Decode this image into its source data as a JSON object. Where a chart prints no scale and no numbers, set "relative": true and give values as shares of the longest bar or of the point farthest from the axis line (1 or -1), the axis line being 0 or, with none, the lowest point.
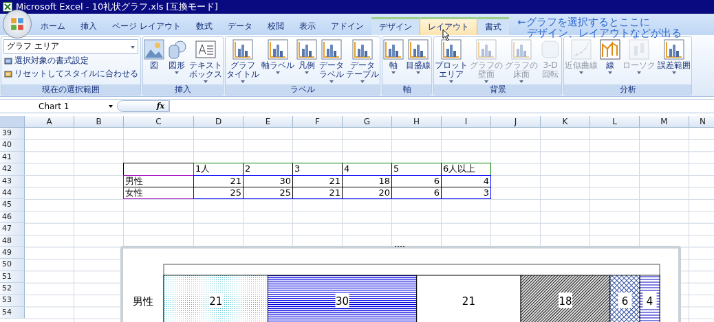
{
  "window": {
    "title": "Microsoft Excel - 10礼状グラフ.xls  [互換モード]"
  },
  "tabs": [
    {
      "label": "ホーム",
      "selected": false,
      "contextual": false
    },
    {
      "label": "挿入",
      "selected": false,
      "contextual": false
    },
    {
      "label": "ページ レイアウト",
      "selected": false,
      "contextual": false
    },
    {
      "label": "数式",
      "selected": false,
      "contextual": false
    },
    {
      "label": "データ",
      "selected": false,
      "contextual": false
    },
    {
      "label": "校閲",
      "selected": false,
      "contextual": false
    },
    {
      "label": "表示",
      "selected": false,
      "contextual": false
    },
    {
      "label": "アドイン",
      "selected": false,
      "contextual": false
    },
    {
      "label": "デザイン",
      "selected": false,
      "contextual": true
    },
    {
      "label": "レイアウト",
      "selected": true,
      "contextual": true
    },
    {
      "label": "書式",
      "selected": false,
      "contextual": true
    }
  ],
  "annotation": [
    "←グラフを選択するとここに",
    "デザイン、レイアウトなどが出る"
  ],
  "ribbon": [
    {
      "label": "現在の選択範囲",
      "kind": "selection",
      "dropdown": "グラフ エリア",
      "links": [
        "選択対象の書式設定",
        "リセットしてスタイルに合わせる"
      ]
    },
    {
      "label": "挿入",
      "kind": "buttons",
      "items": [
        {
          "lines": [
            "図"
          ],
          "dropdown": false,
          "disabled": false
        },
        {
          "lines": [
            "図形"
          ],
          "dropdown": true,
          "disabled": false
        },
        {
          "lines": [
            "テキスト",
            "ボックス"
          ],
          "dropdown": true,
          "disabled": false
        }
      ]
    },
    {
      "label": "ラベル",
      "kind": "buttons",
      "items": [
        {
          "lines": [
            "グラフ",
            "タイトル"
          ],
          "dropdown": true,
          "disabled": false
        },
        {
          "lines": [
            "軸ラベル"
          ],
          "dropdown": true,
          "disabled": false
        },
        {
          "lines": [
            "凡例"
          ],
          "dropdown": true,
          "disabled": false
        },
        {
          "lines": [
            "データ",
            "ラベル"
          ],
          "dropdown": true,
          "disabled": false
        },
        {
          "lines": [
            "データ",
            "テーブル"
          ],
          "dropdown": true,
          "disabled": false
        }
      ]
    },
    {
      "label": "軸",
      "kind": "buttons",
      "items": [
        {
          "lines": [
            "軸"
          ],
          "dropdown": true,
          "disabled": false
        },
        {
          "lines": [
            "目盛線"
          ],
          "dropdown": true,
          "disabled": false
        }
      ]
    },
    {
      "label": "背景",
      "kind": "buttons",
      "items": [
        {
          "lines": [
            "プロット",
            "エリア"
          ],
          "dropdown": true,
          "disabled": false
        },
        {
          "lines": [
            "グラフの",
            "壁面"
          ],
          "dropdown": true,
          "disabled": true
        },
        {
          "lines": [
            "グラフの",
            "床面"
          ],
          "dropdown": true,
          "disabled": true
        },
        {
          "lines": [
            "3-D",
            "回転"
          ],
          "dropdown": false,
          "disabled": true
        }
      ]
    },
    {
      "label": "分析",
      "kind": "buttons",
      "items": [
        {
          "lines": [
            "近似曲線"
          ],
          "dropdown": true,
          "disabled": true
        },
        {
          "lines": [
            "線"
          ],
          "dropdown": true,
          "disabled": false
        },
        {
          "lines": [
            "ローソク"
          ],
          "dropdown": true,
          "disabled": true
        },
        {
          "lines": [
            "誤差範囲"
          ],
          "dropdown": true,
          "disabled": false
        }
      ]
    }
  ],
  "formula_bar": {
    "name_box": "Chart 1",
    "fx": "fx"
  },
  "sheet": {
    "columns": [
      "A",
      "B",
      "C",
      "D",
      "E",
      "F",
      "G",
      "H",
      "I",
      "J",
      "K",
      "L",
      "M",
      "N"
    ],
    "row_numbers": [
      "39",
      "40",
      "41",
      "42",
      "43",
      "44",
      "45",
      "46",
      "47",
      "48",
      "49",
      "50",
      "51",
      "52",
      "53",
      "54"
    ],
    "data_table": {
      "header": [
        "1人",
        "2",
        "3",
        "4",
        "5",
        "6人以上"
      ],
      "rows": [
        {
          "label": "男性",
          "values": [
            "21",
            "30",
            "21",
            "18",
            "6",
            "4"
          ]
        },
        {
          "label": "女性",
          "values": [
            "25",
            "25",
            "21",
            "20",
            "6",
            "3"
          ]
        }
      ],
      "highlights": [
        {
          "kind": "header",
          "color": "#008000"
        },
        {
          "kind": "labels",
          "color": "#a000c0"
        },
        {
          "kind": "values",
          "color": "#0000ff"
        }
      ]
    }
  },
  "chart": {
    "chart_data": {
      "type": "bar",
      "orientation": "horizontal",
      "stacked": true,
      "categories": [
        "男性"
      ],
      "relative": true,
      "value_labels": [
        "21",
        "30",
        "21",
        "18",
        "6",
        "4"
      ],
      "series": [
        {
          "color": "#40c0d0",
          "values": [
            0.21
          ]
        },
        {
          "color": "#0000e0",
          "values": [
            0.3
          ]
        },
        {
          "color": "#ffffff",
          "values": [
            0.21
          ]
        },
        {
          "color": "#202020",
          "values": [
            0.18
          ]
        },
        {
          "color": "#3050a0",
          "values": [
            0.06
          ]
        },
        {
          "color": "#8080e0",
          "values": [
            0.04
          ]
        }
      ]
    }
  }
}
